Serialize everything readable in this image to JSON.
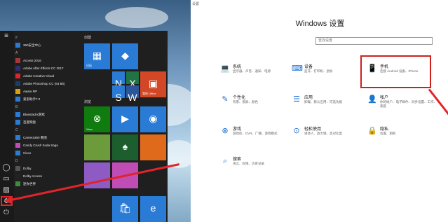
{
  "start_menu": {
    "apps": [
      {
        "label": "#",
        "letter": true
      },
      {
        "label": "360安全中心",
        "color": "#2a7bd6"
      },
      {
        "label": "A",
        "letter": true
      },
      {
        "label": "Access 2016",
        "color": "#a4373a"
      },
      {
        "label": "Adobe After Effects CC 2017",
        "color": "#2f2f6f"
      },
      {
        "label": "Adobe Creative Cloud",
        "color": "#d9262a"
      },
      {
        "label": "Adobe Photoshop CC (64 Bit)",
        "color": "#1c3b6b"
      },
      {
        "label": "Aware RP",
        "color": "#d9a200"
      },
      {
        "label": "爱思助手7.0",
        "color": "#2a7bd6"
      },
      {
        "label": "B",
        "letter": true
      },
      {
        "label": "Bluestacks游戏",
        "color": "#2a7bd6"
      },
      {
        "label": "百度网盘",
        "color": "#2a7bd6"
      },
      {
        "label": "C",
        "letter": true
      },
      {
        "label": "Camera360 看图",
        "color": "#2a7bd6"
      },
      {
        "label": "Candy Crush Soda Saga",
        "color": "#c04db5"
      },
      {
        "label": "Cisco",
        "color": "#2a7bd6"
      },
      {
        "label": "D",
        "letter": true
      },
      {
        "label": "Dolby",
        "color": "#555555"
      },
      {
        "label": "Dolby Access",
        "color": "#222222"
      },
      {
        "label": "迷你世界",
        "color": "#3a8f3a"
      }
    ],
    "groups": [
      "创建",
      "浏览"
    ],
    "tiles": [
      {
        "label": "日历",
        "icon": "calendar-icon",
        "glyph": "▦",
        "color": "#2a7bd6"
      },
      {
        "label": "",
        "icon": "paint3d-icon",
        "glyph": "◆",
        "color": "#2a7bd6"
      },
      {
        "label": "我的 Office",
        "icon": "office-icon",
        "glyph": "▣",
        "color": "#d24726"
      },
      {
        "label": "",
        "icon": "onenote-icon",
        "glyph": "N",
        "color": "#2a7bd6"
      },
      {
        "label": "",
        "icon": "skype-icon",
        "glyph": "S",
        "color": "#2a7bd6"
      },
      {
        "label": "",
        "icon": "excel-icon",
        "glyph": "X",
        "color": "#217346"
      },
      {
        "label": "",
        "icon": "word-icon",
        "glyph": "W",
        "color": "#2b579a"
      },
      {
        "label": "Xbox",
        "icon": "xbox-icon",
        "glyph": "⊗",
        "color": "#107c10"
      },
      {
        "label": "",
        "icon": "movies-icon",
        "glyph": "▶",
        "color": "#2a7bd6"
      },
      {
        "label": "",
        "icon": "groove-icon",
        "glyph": "◉",
        "color": "#2a7bd6"
      },
      {
        "label": "",
        "icon": "minecraft-icon",
        "glyph": "",
        "color": "#6b9b3a"
      },
      {
        "label": "",
        "icon": "solitaire-icon",
        "glyph": "♠",
        "color": "#1d5e2e"
      },
      {
        "label": "",
        "icon": "sunrise-icon",
        "glyph": "",
        "color": "#e06a1c"
      },
      {
        "label": "",
        "icon": "disney-icon",
        "glyph": "",
        "color": "#8e5bc4"
      },
      {
        "label": "",
        "icon": "candy-icon",
        "glyph": "",
        "color": "#c04db5"
      },
      {
        "label": "",
        "icon": "store-icon",
        "glyph": "🛍",
        "color": "#2a7bd6"
      },
      {
        "label": "",
        "icon": "edge-icon",
        "glyph": "e",
        "color": "#2a7bd6"
      }
    ]
  },
  "settings": {
    "window_title": "设置",
    "title": "Windows 设置",
    "search_placeholder": "查找设置",
    "categories": [
      {
        "name": "系统",
        "desc": "显示器、声音、通知、电源",
        "icon": "laptop-icon",
        "glyph": "💻"
      },
      {
        "name": "设备",
        "desc": "蓝牙、打印机、鼠标",
        "icon": "keyboard-icon",
        "glyph": "⌨"
      },
      {
        "name": "手机",
        "desc": "连接 Android 设备、iPhone",
        "icon": "phone-icon",
        "glyph": "📱"
      },
      {
        "name": "个性化",
        "desc": "背景、锁屏、颜色",
        "icon": "brush-icon",
        "glyph": "✎"
      },
      {
        "name": "应用",
        "desc": "卸载、默认应用、可选功能",
        "icon": "apps-icon",
        "glyph": "☰"
      },
      {
        "name": "帐户",
        "desc": "你的帐户、电子邮件、同步设置、工作、家庭",
        "icon": "account-icon",
        "glyph": "👤"
      },
      {
        "name": "游戏",
        "desc": "游戏栏、DVR、广播、游戏模式",
        "icon": "xbox-icon",
        "glyph": "⊗"
      },
      {
        "name": "轻松使用",
        "desc": "讲述人、放大镜、高对比度",
        "icon": "ease-of-access-icon",
        "glyph": "⊙"
      },
      {
        "name": "隐私",
        "desc": "位置、相机",
        "icon": "lock-icon",
        "glyph": "🔒"
      },
      {
        "name": "搜索",
        "desc": "语言、权限、历史记录",
        "icon": "search-icon",
        "glyph": "⌕"
      }
    ]
  },
  "colors": {
    "highlight": "#e0242a",
    "accent": "#1c6fd1"
  }
}
